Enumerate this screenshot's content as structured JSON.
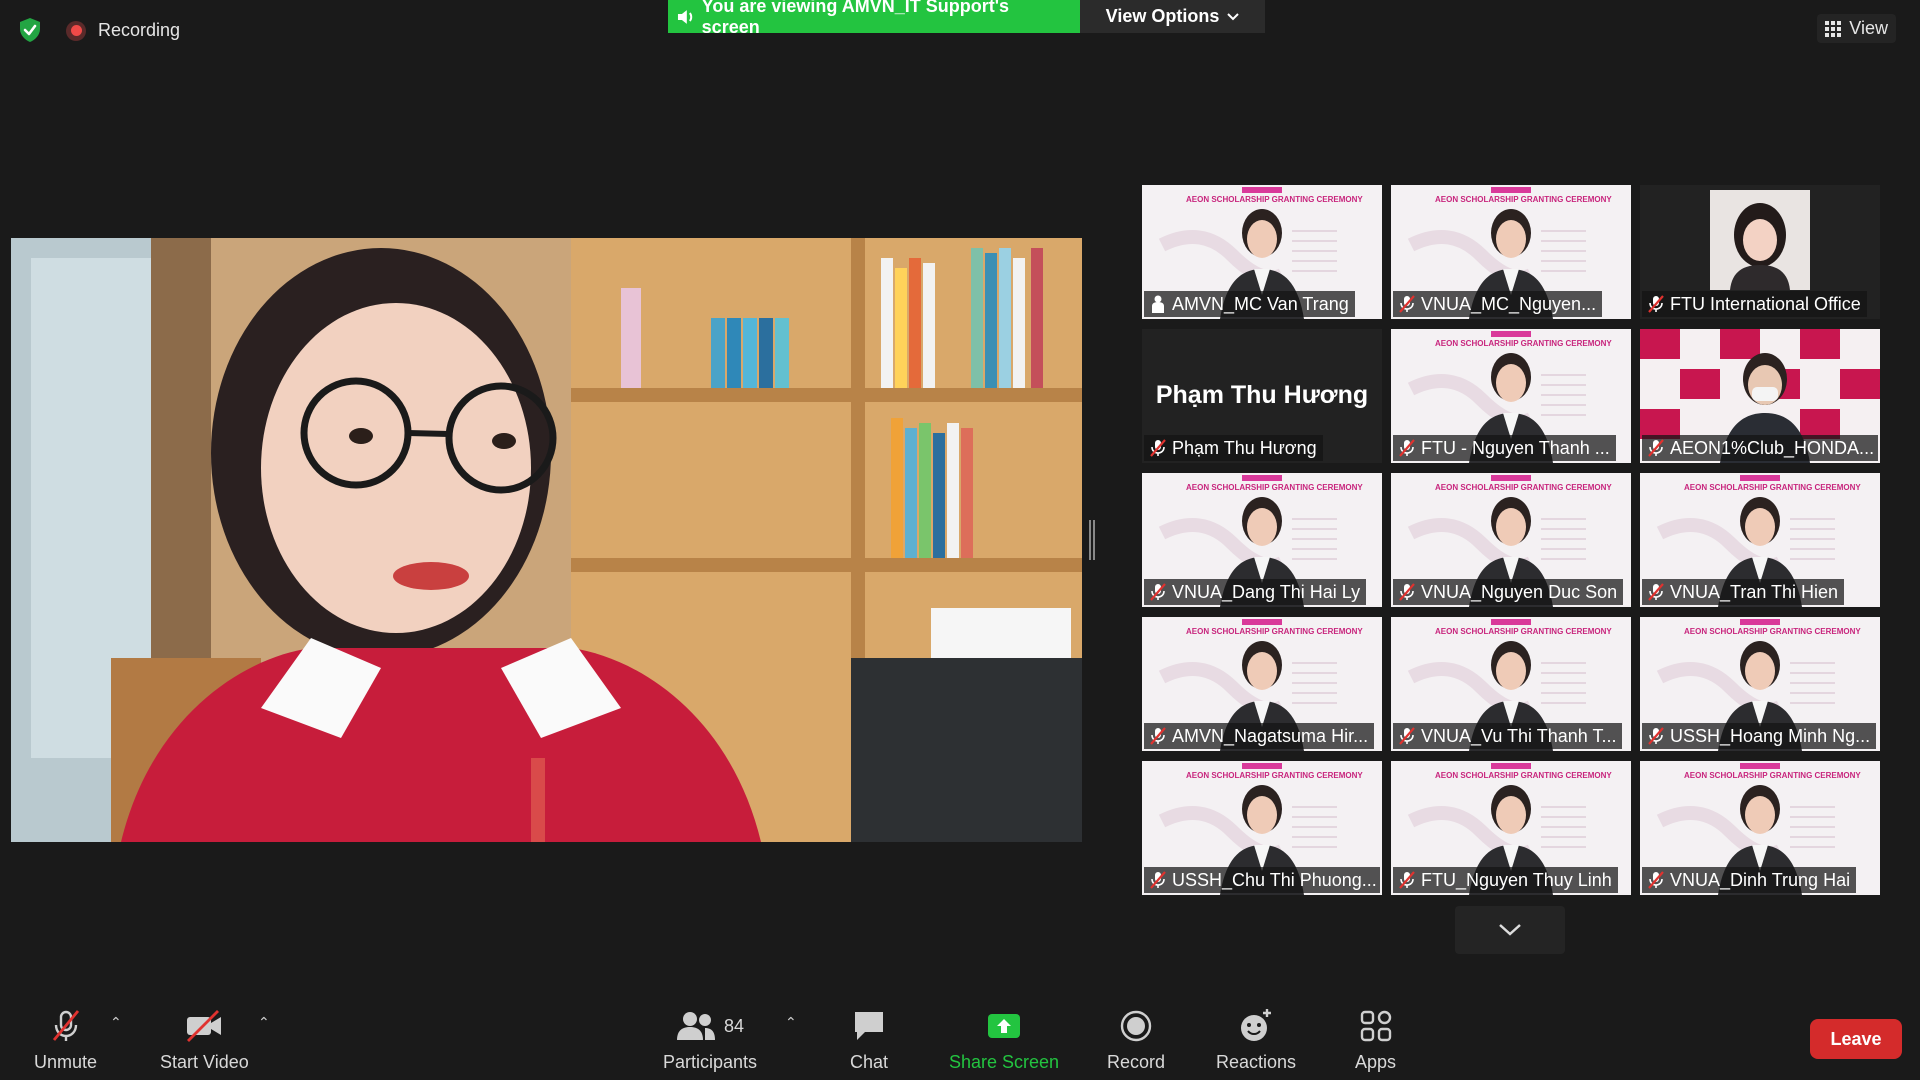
{
  "status": {
    "recording_label": "Recording"
  },
  "banner": {
    "viewing_text": "You are viewing AMVN_IT Support's screen",
    "view_options_label": "View Options"
  },
  "view_label": "View",
  "gallery": {
    "tiles": [
      {
        "name": "AMVN_MC Van Trang",
        "style": "slide",
        "muted": false
      },
      {
        "name": "VNUA_MC_Nguyen...",
        "style": "slide",
        "muted": true
      },
      {
        "name": "FTU International Office",
        "style": "photo",
        "muted": true
      },
      {
        "name": "Phạm Thu Hương",
        "style": "name",
        "muted": true,
        "big_name": "Phạm Thu Hương"
      },
      {
        "name": "FTU - Nguyen Thanh ...",
        "style": "slide",
        "muted": true
      },
      {
        "name": "AEON1%Club_HONDA...",
        "style": "aeon",
        "muted": true
      },
      {
        "name": "VNUA_Dang Thi Hai Ly",
        "style": "slide",
        "muted": true
      },
      {
        "name": "VNUA_Nguyen Duc Son",
        "style": "slide",
        "muted": true
      },
      {
        "name": "VNUA_Tran Thi Hien",
        "style": "slide",
        "muted": true
      },
      {
        "name": "AMVN_Nagatsuma Hir...",
        "style": "slide",
        "muted": true
      },
      {
        "name": "VNUA_Vu Thi Thanh T...",
        "style": "slide",
        "muted": true
      },
      {
        "name": "USSH_Hoang Minh Ng...",
        "style": "slide",
        "muted": true
      },
      {
        "name": "USSH_Chu Thi Phuong...",
        "style": "slide",
        "muted": true
      },
      {
        "name": "FTU_Nguyen Thuy Linh",
        "style": "slide",
        "muted": true
      },
      {
        "name": "VNUA_Dinh Trung Hai",
        "style": "slide",
        "muted": true
      }
    ]
  },
  "toolbar": {
    "unmute_label": "Unmute",
    "start_video_label": "Start Video",
    "participants_label": "Participants",
    "participants_count": "84",
    "chat_label": "Chat",
    "share_screen_label": "Share Screen",
    "record_label": "Record",
    "reactions_label": "Reactions",
    "apps_label": "Apps",
    "leave_label": "Leave"
  },
  "colors": {
    "accent_green": "#23c440",
    "leave_red": "#d42b2b",
    "background": "#1a1a1a"
  }
}
